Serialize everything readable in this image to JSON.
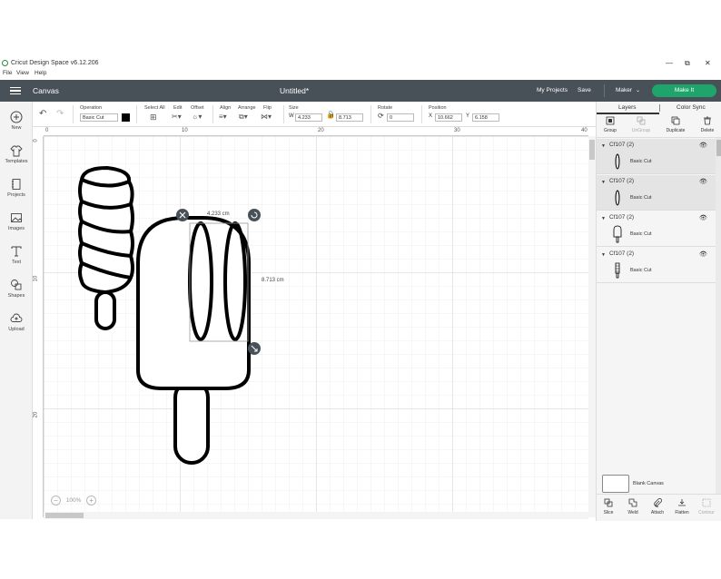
{
  "window": {
    "app_title": "Cricut Design Space  v6.12.206",
    "min_icon": "minimize-icon",
    "max_icon": "restore-icon",
    "close_icon": "close-icon"
  },
  "menu": [
    "File",
    "View",
    "Help"
  ],
  "header": {
    "section": "Canvas",
    "doc_title": "Untitled*",
    "my_projects": "My Projects",
    "save": "Save",
    "machine": "Maker",
    "make_it": "Make It"
  },
  "colors": {
    "header_bg": "#485058",
    "make_it": "#1fa56b",
    "canvas_grid": "#e6e6e6"
  },
  "toolbar": {
    "operation_label": "Operation",
    "operation_value": "Basic Cut",
    "select_all_label": "Select All",
    "edit_label": "Edit",
    "offset_label": "Offset",
    "align_label": "Align",
    "arrange_label": "Arrange",
    "flip_label": "Flip",
    "size_label": "Size",
    "w_label": "W",
    "w_value": "4.233",
    "h_label": "H",
    "h_value": "8.713",
    "rotate_label": "Rotate",
    "rotate_value": "0",
    "position_label": "Position",
    "x_label": "X",
    "x_value": "10.662",
    "y_label": "Y",
    "y_value": "6.158"
  },
  "sidebar": {
    "items": [
      {
        "label": "New",
        "icon": "plus-circle-icon"
      },
      {
        "label": "Templates",
        "icon": "shirt-icon"
      },
      {
        "label": "Projects",
        "icon": "book-icon"
      },
      {
        "label": "Images",
        "icon": "image-icon"
      },
      {
        "label": "Text",
        "icon": "text-icon"
      },
      {
        "label": "Shapes",
        "icon": "shapes-icon"
      },
      {
        "label": "Upload",
        "icon": "cloud-upload-icon"
      }
    ]
  },
  "rulers": {
    "top": [
      "0",
      "10",
      "20",
      "30",
      "40"
    ],
    "left": [
      "0",
      "10",
      "20"
    ]
  },
  "canvas": {
    "width_dim": "4.233 cm",
    "height_dim": "8.713 cm",
    "zoom": "100%"
  },
  "panel": {
    "tabs": [
      "Layers",
      "Color Sync"
    ],
    "actions": [
      "Group",
      "UnGroup",
      "Duplicate",
      "Delete"
    ],
    "layers": [
      {
        "name": "Cf107 (2)",
        "op": "Basic Cut",
        "selected": true
      },
      {
        "name": "Cf107 (2)",
        "op": "Basic Cut",
        "selected": true
      },
      {
        "name": "Cf107 (2)",
        "op": "Basic Cut",
        "selected": false
      },
      {
        "name": "Cf107 (2)",
        "op": "Basic Cut",
        "selected": false
      }
    ],
    "blank_canvas": "Blank Canvas",
    "bottom": [
      "Slice",
      "Weld",
      "Attach",
      "Flatten",
      "Contour"
    ]
  }
}
